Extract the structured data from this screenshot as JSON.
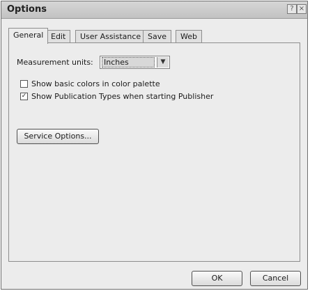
{
  "dialog": {
    "title": "Options",
    "help_label": "?",
    "close_label": "×"
  },
  "tabs": [
    {
      "label": "General",
      "active": true
    },
    {
      "label": "Edit"
    },
    {
      "label": "User Assistance"
    },
    {
      "label": "Save"
    },
    {
      "label": "Web"
    }
  ],
  "general": {
    "measurement_label": "Measurement units:",
    "measurement_value": "Inches",
    "dropdown_arrow": "▼",
    "show_basic_colors": {
      "label": "Show basic colors in color palette",
      "checked": false
    },
    "show_publication_types": {
      "label": "Show Publication Types when starting Publisher",
      "checked": true,
      "mark": "✓"
    },
    "service_options_label": "Service Options..."
  },
  "buttons": {
    "ok": "OK",
    "cancel": "Cancel"
  }
}
